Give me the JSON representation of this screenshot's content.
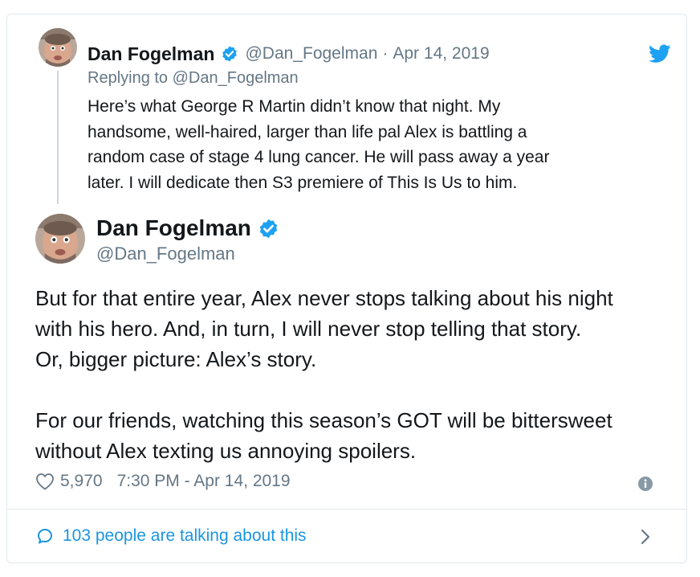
{
  "parent_tweet": {
    "name": "Dan Fogelman",
    "handle": "@Dan_Fogelman",
    "separator": "·",
    "date": "Apr 14, 2019",
    "replying_prefix": "Replying to",
    "replying_to": "@Dan_Fogelman",
    "text": "Here’s what George R Martin didn’t know that night. My\nhandsome, well-haired, larger than life pal Alex is battling a\nrandom case of stage 4 lung cancer.  He will pass away a year\nlater. I will dedicate then S3 premiere of This Is Us to him."
  },
  "main_tweet": {
    "name": "Dan Fogelman",
    "handle": "@Dan_Fogelman",
    "paragraphs": [
      "But for that entire year, Alex never stops talking about his night\nwith his hero. And, in turn, I will never stop telling that story.\nOr, bigger picture: Alex’s story.",
      "For our friends, watching this season’s GOT will be bittersweet\nwithout Alex texting us annoying spoilers."
    ],
    "likes": "5,970",
    "timestamp": "7:30 PM - Apr 14, 2019"
  },
  "footer": {
    "talking": "103 people are talking about this"
  },
  "colors": {
    "twitter_blue": "#1da1f2",
    "link_blue": "#1b95e0",
    "secondary_text": "#657786",
    "border": "#e1e8ed"
  },
  "icons": {
    "verified": "verified-badge-icon",
    "brand": "twitter-bird-icon",
    "like": "heart-outline-icon",
    "info": "info-circle-icon",
    "reply": "speech-bubble-icon",
    "chevron": "chevron-right-icon"
  }
}
